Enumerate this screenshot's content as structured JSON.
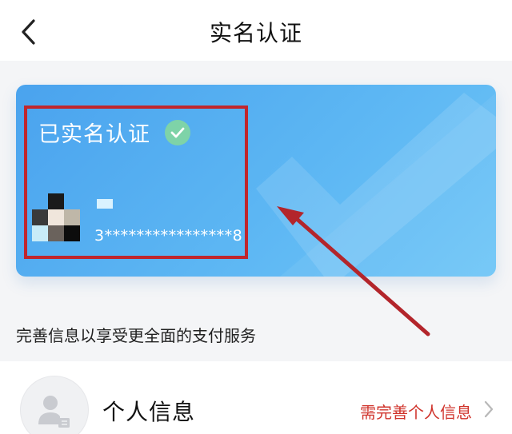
{
  "header": {
    "title": "实名认证",
    "back_icon": "chevron-left-icon"
  },
  "card": {
    "status_text": "已实名认证",
    "status_icon": "check-circle-icon",
    "id_number": "3****************8",
    "gradient_colors": [
      "#4aa3ee",
      "#6fc6f7"
    ],
    "badge_color": "#7ed3a8",
    "highlight_color": "#c0262d"
  },
  "annotation": {
    "arrow_color": "#c0262d"
  },
  "hint": "完善信息以享受更全面的支付服务",
  "personal_info": {
    "label": "个人信息",
    "action": "需完善个人信息",
    "action_color": "#d0342c",
    "icon": "user-id-icon"
  }
}
